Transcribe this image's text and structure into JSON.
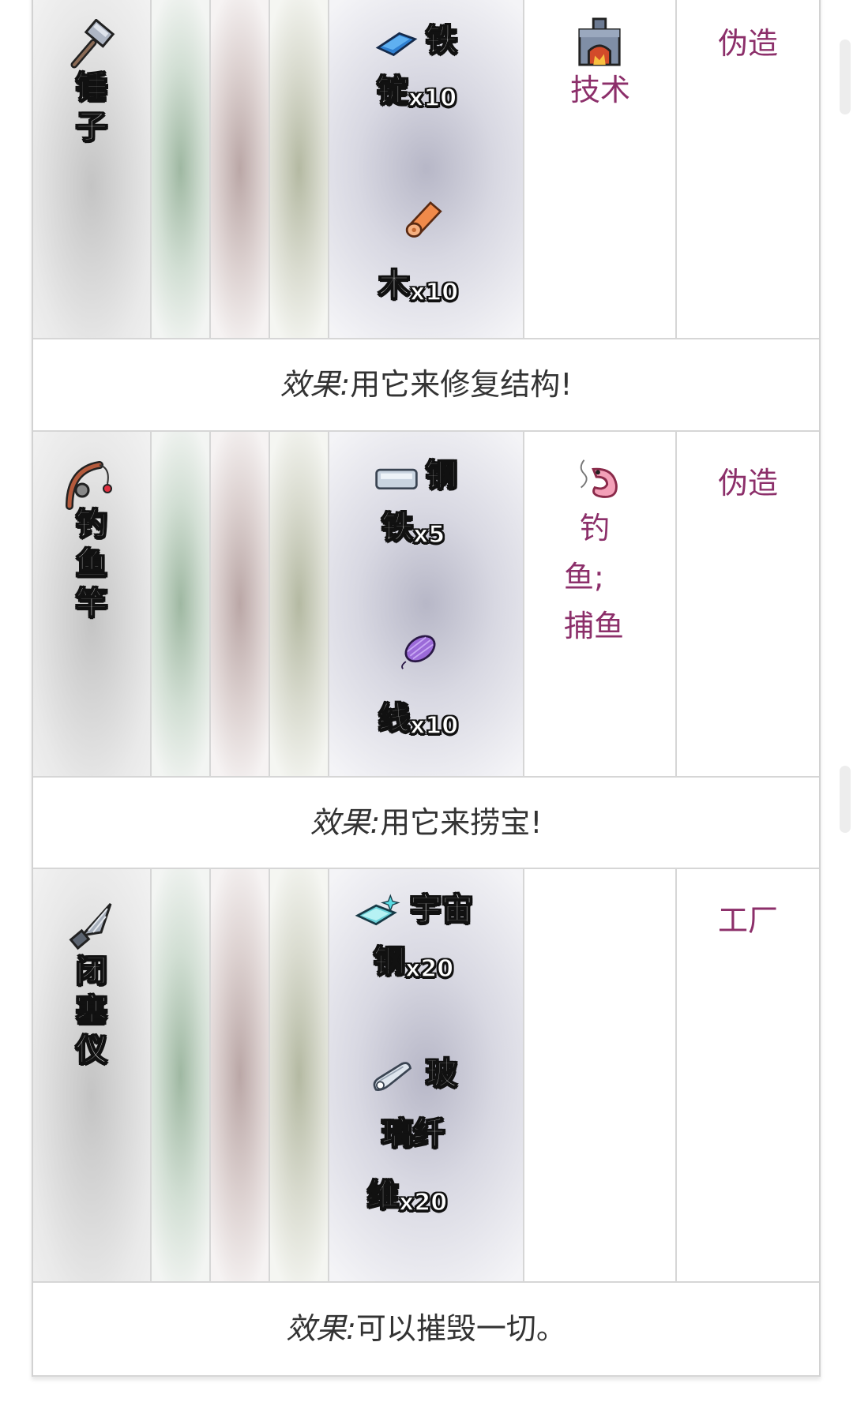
{
  "colors": {
    "link": "#8c2f6a",
    "border": "#d6d6d6",
    "text": "#333333"
  },
  "recipes": [
    {
      "item": {
        "name": "锤子",
        "icon": "hammer-icon"
      },
      "materials": [
        {
          "name_line1": "铁",
          "name_line2": "锭",
          "qty": "x10",
          "icon": "iron-ingot-icon"
        },
        {
          "name_line1": "木",
          "qty": "x10",
          "icon": "wood-log-icon"
        }
      ],
      "station": {
        "label": "技术",
        "icon": "furnace-icon"
      },
      "type": "伪造",
      "effect": {
        "label": "效果:",
        "text": "用它来修复结构!"
      }
    },
    {
      "item": {
        "name": "钓鱼竿",
        "icon": "fishing-rod-icon"
      },
      "materials": [
        {
          "name_line1": "钢",
          "name_line2": "铁",
          "qty": "x5",
          "icon": "steel-bar-icon"
        },
        {
          "name_line1": "线",
          "qty": "x10",
          "icon": "thread-icon"
        }
      ],
      "station": {
        "label_line1": "钓",
        "label_line2": "鱼;",
        "label_line3": "捕鱼",
        "icon": "shrimp-icon"
      },
      "type": "伪造",
      "effect": {
        "label": "效果:",
        "text": "用它来捞宝!"
      }
    },
    {
      "item": {
        "name": "闭塞仪",
        "icon": "drill-icon"
      },
      "materials": [
        {
          "name_line1": "宇宙",
          "name_line2": "钢",
          "qty": "x20",
          "icon": "cosmic-steel-icon"
        },
        {
          "name_line1": "玻",
          "name_line2": "璃纤",
          "name_line3": "维",
          "qty": "x20",
          "icon": "fiberglass-icon"
        }
      ],
      "type": "工厂",
      "effect": {
        "label": "效果:",
        "text": "可以摧毁一切。"
      }
    }
  ]
}
